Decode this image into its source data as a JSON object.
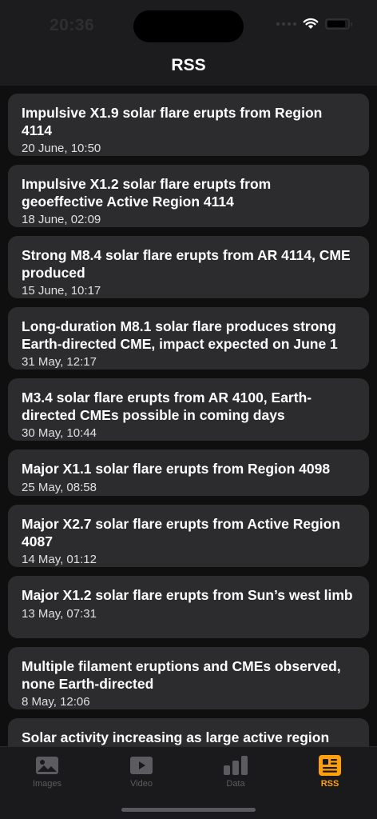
{
  "status": {
    "time": "20:36"
  },
  "nav": {
    "title": "RSS"
  },
  "articles": [
    {
      "title": "Impulsive X1.9 solar flare erupts from Region 4114",
      "date": "20 June, 10:50"
    },
    {
      "title": "Impulsive X1.2 solar flare erupts from geoeffective Active Region 4114",
      "date": "18 June, 02:09"
    },
    {
      "title": "Strong M8.4 solar flare erupts from AR 4114, CME produced",
      "date": "15 June, 10:17"
    },
    {
      "title": "Long-duration M8.1 solar flare produces strong Earth-directed CME, impact expected on June 1",
      "date": "31 May, 12:17"
    },
    {
      "title": "M3.4 solar flare erupts from AR 4100, Earth-directed CMEs possible in coming days",
      "date": "30 May, 10:44"
    },
    {
      "title": "Major X1.1 solar flare erupts from Region 4098",
      "date": "25 May, 08:58"
    },
    {
      "title": "Major X2.7 solar flare erupts from Active Region 4087",
      "date": "14 May, 01:12"
    },
    {
      "title": "Major X1.2 solar flare erupts from Sun’s west limb",
      "date": "13 May, 07:31"
    },
    {
      "title": "Multiple filament eruptions and CMEs observed, none Earth-directed",
      "date": "8 May, 12:06"
    },
    {
      "title": "Solar activity increasing as large active region",
      "date": ""
    }
  ],
  "tabs": [
    {
      "label": "Images",
      "icon": "photo-icon"
    },
    {
      "label": "Video",
      "icon": "play-icon"
    },
    {
      "label": "Data",
      "icon": "bar-chart-icon"
    },
    {
      "label": "RSS",
      "icon": "newspaper-icon"
    }
  ],
  "colors": {
    "accent": "#ff9f0a",
    "card": "#2c2c2e",
    "background": "#1c1c1e"
  }
}
